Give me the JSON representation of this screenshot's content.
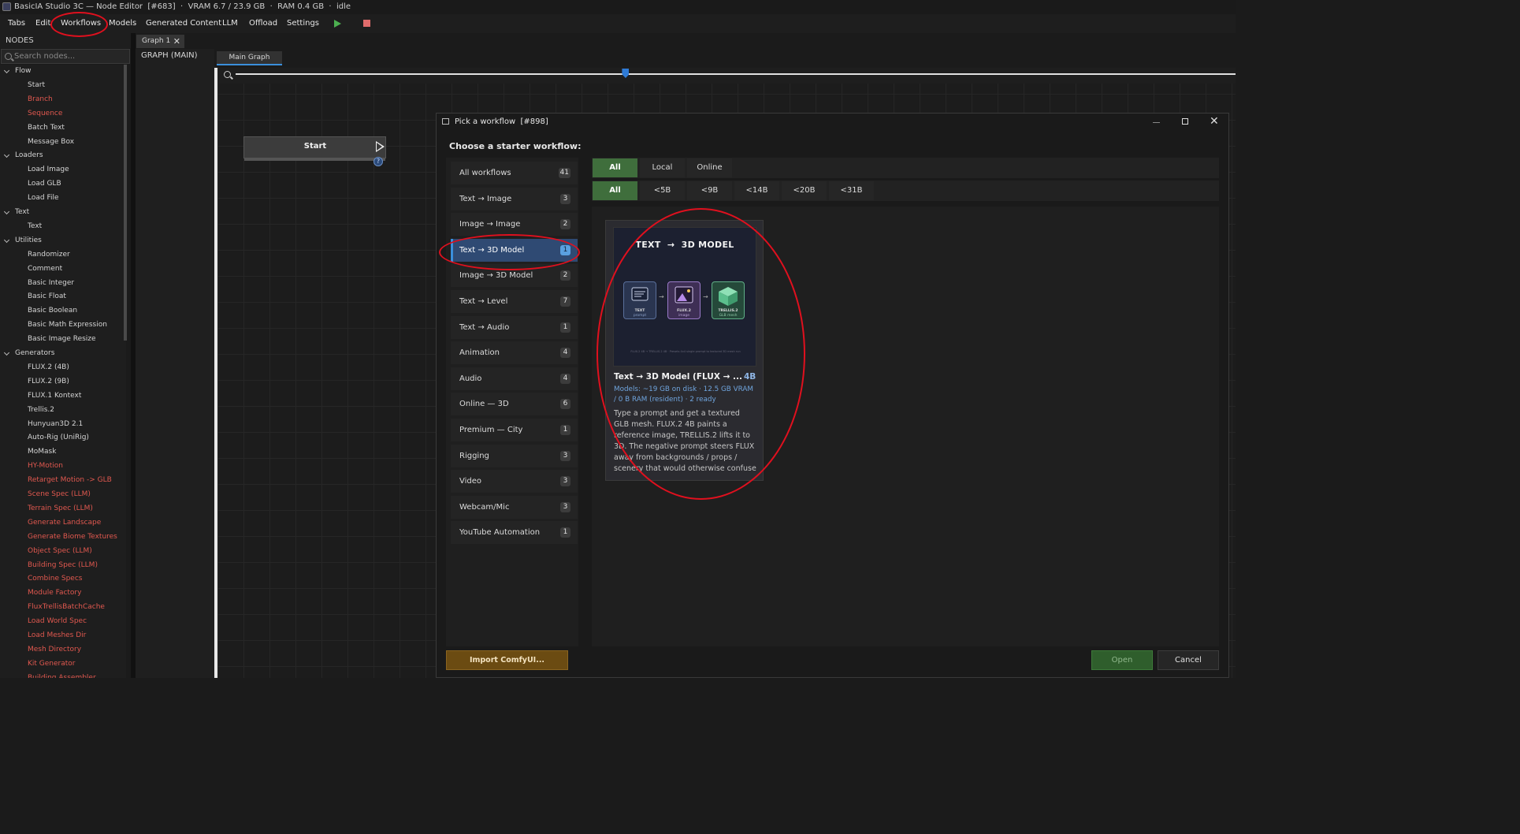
{
  "window": {
    "title": "BasicIA Studio 3C — Node Editor  [#683]  ·  VRAM 6.7 / 23.9 GB  ·  RAM 0.4 GB  ·  idle"
  },
  "menubar": {
    "items": [
      "Tabs",
      "Edit",
      "Workflows",
      "Models",
      "Generated Content",
      "LLM",
      "Offload",
      "Settings"
    ],
    "play_icon": "play-icon",
    "stop_icon": "stop-icon"
  },
  "nodes_panel": {
    "header": "NODES",
    "search_placeholder": "Search nodes...",
    "tree": [
      {
        "type": "category",
        "label": "Flow"
      },
      {
        "type": "node",
        "label": "Start",
        "color": "white"
      },
      {
        "type": "node",
        "label": "Branch",
        "color": "red"
      },
      {
        "type": "node",
        "label": "Sequence",
        "color": "red"
      },
      {
        "type": "node",
        "label": "Batch Text",
        "color": "white"
      },
      {
        "type": "node",
        "label": "Message Box",
        "color": "white"
      },
      {
        "type": "category",
        "label": "Loaders"
      },
      {
        "type": "node",
        "label": "Load Image",
        "color": "white"
      },
      {
        "type": "node",
        "label": "Load GLB",
        "color": "white"
      },
      {
        "type": "node",
        "label": "Load File",
        "color": "white"
      },
      {
        "type": "category",
        "label": "Text"
      },
      {
        "type": "node",
        "label": "Text",
        "color": "white"
      },
      {
        "type": "category",
        "label": "Utilities"
      },
      {
        "type": "node",
        "label": "Randomizer",
        "color": "white"
      },
      {
        "type": "node",
        "label": "Comment",
        "color": "white"
      },
      {
        "type": "node",
        "label": "Basic Integer",
        "color": "white"
      },
      {
        "type": "node",
        "label": "Basic Float",
        "color": "white"
      },
      {
        "type": "node",
        "label": "Basic Boolean",
        "color": "white"
      },
      {
        "type": "node",
        "label": "Basic Math Expression",
        "color": "white"
      },
      {
        "type": "node",
        "label": "Basic Image Resize",
        "color": "white"
      },
      {
        "type": "category",
        "label": "Generators"
      },
      {
        "type": "node",
        "label": "FLUX.2 (4B)",
        "color": "white"
      },
      {
        "type": "node",
        "label": "FLUX.2 (9B)",
        "color": "white"
      },
      {
        "type": "node",
        "label": "FLUX.1 Kontext",
        "color": "white"
      },
      {
        "type": "node",
        "label": "Trellis.2",
        "color": "white"
      },
      {
        "type": "node",
        "label": "Hunyuan3D 2.1",
        "color": "white"
      },
      {
        "type": "node",
        "label": "Auto-Rig (UniRig)",
        "color": "white"
      },
      {
        "type": "node",
        "label": "MoMask",
        "color": "white"
      },
      {
        "type": "node",
        "label": "HY-Motion",
        "color": "red"
      },
      {
        "type": "node",
        "label": "Retarget Motion -> GLB",
        "color": "red"
      },
      {
        "type": "node",
        "label": "Scene Spec (LLM)",
        "color": "red"
      },
      {
        "type": "node",
        "label": "Terrain Spec (LLM)",
        "color": "red"
      },
      {
        "type": "node",
        "label": "Generate Landscape",
        "color": "red"
      },
      {
        "type": "node",
        "label": "Generate Biome Textures",
        "color": "red"
      },
      {
        "type": "node",
        "label": "Object Spec (LLM)",
        "color": "red"
      },
      {
        "type": "node",
        "label": "Building Spec (LLM)",
        "color": "red"
      },
      {
        "type": "node",
        "label": "Combine Specs",
        "color": "red"
      },
      {
        "type": "node",
        "label": "Module Factory",
        "color": "red"
      },
      {
        "type": "node",
        "label": "FluxTrellisBatchCache",
        "color": "red"
      },
      {
        "type": "node",
        "label": "Load World Spec",
        "color": "red"
      },
      {
        "type": "node",
        "label": "Load Meshes Dir",
        "color": "red"
      },
      {
        "type": "node",
        "label": "Mesh Directory",
        "color": "red"
      },
      {
        "type": "node",
        "label": "Kit Generator",
        "color": "red"
      },
      {
        "type": "node",
        "label": "Building Assembler",
        "color": "red"
      }
    ]
  },
  "graph": {
    "file_tab": "Graph 1",
    "file_tab_close": "✕",
    "panel_label": "GRAPH (MAIN)",
    "sub_tab": "Main Graph",
    "zoom_level": 0.39,
    "start_node": {
      "label": "Start",
      "help": "?"
    }
  },
  "dialog": {
    "title": "Pick a workflow  [#898]",
    "prompt": "Choose a starter workflow:",
    "close": "✕",
    "categories": [
      {
        "label": "All workflows",
        "count": "41"
      },
      {
        "label": "Text → Image",
        "count": "3"
      },
      {
        "label": "Image → Image",
        "count": "2"
      },
      {
        "label": "Text → 3D Model",
        "count": "1",
        "selected": true
      },
      {
        "label": "Image → 3D Model",
        "count": "2"
      },
      {
        "label": "Text → Level",
        "count": "7"
      },
      {
        "label": "Text → Audio",
        "count": "1"
      },
      {
        "label": "Animation",
        "count": "4"
      },
      {
        "label": "Audio",
        "count": "4"
      },
      {
        "label": "Online — 3D",
        "count": "6"
      },
      {
        "label": "Premium — City",
        "count": "1"
      },
      {
        "label": "Rigging",
        "count": "3"
      },
      {
        "label": "Video",
        "count": "3"
      },
      {
        "label": "Webcam/Mic",
        "count": "3"
      },
      {
        "label": "YouTube Automation",
        "count": "1"
      }
    ],
    "source_filters": [
      "All",
      "Local",
      "Online"
    ],
    "size_filters": [
      "All",
      "<5B",
      "<9B",
      "<14B",
      "<20B",
      "<31B"
    ],
    "card": {
      "thumb_title": "TEXT  →  3D MODEL",
      "thumb_steps": [
        {
          "label": "TEXT",
          "sub": "prompt"
        },
        {
          "label": "FLUX.2",
          "sub": "image"
        },
        {
          "label": "TRELLIS.2",
          "sub": "GLB mesh"
        }
      ],
      "thumb_footer": "FLUX.2 4B  →  TRELLIS.2 4B  ·  Presets 4x4 single prompt to textured 3D mesh run",
      "title": "Text → 3D Model (FLUX → ...",
      "size": "4B",
      "models": "Models: ~19 GB on disk · 12.5 GB VRAM / 0 B RAM (resident) · 2 ready",
      "description": "Type a prompt and get a textured GLB mesh. FLUX.2 4B paints a reference image, TRELLIS.2 lifts it to 3D. The negative prompt steers FLUX away from backgrounds / props / scenery that would otherwise confuse"
    },
    "buttons": {
      "import": "Import ComfyUI...",
      "open": "Open",
      "cancel": "Cancel"
    }
  },
  "colors": {
    "accent_blue": "#3b8fdc",
    "selected_bg": "#2f4a73",
    "filter_on": "#3f6e3c",
    "import_btn": "#6b4b12",
    "open_btn": "#2f5e2c",
    "annotation_red": "#e0101e",
    "node_red_text": "#e0584f"
  }
}
